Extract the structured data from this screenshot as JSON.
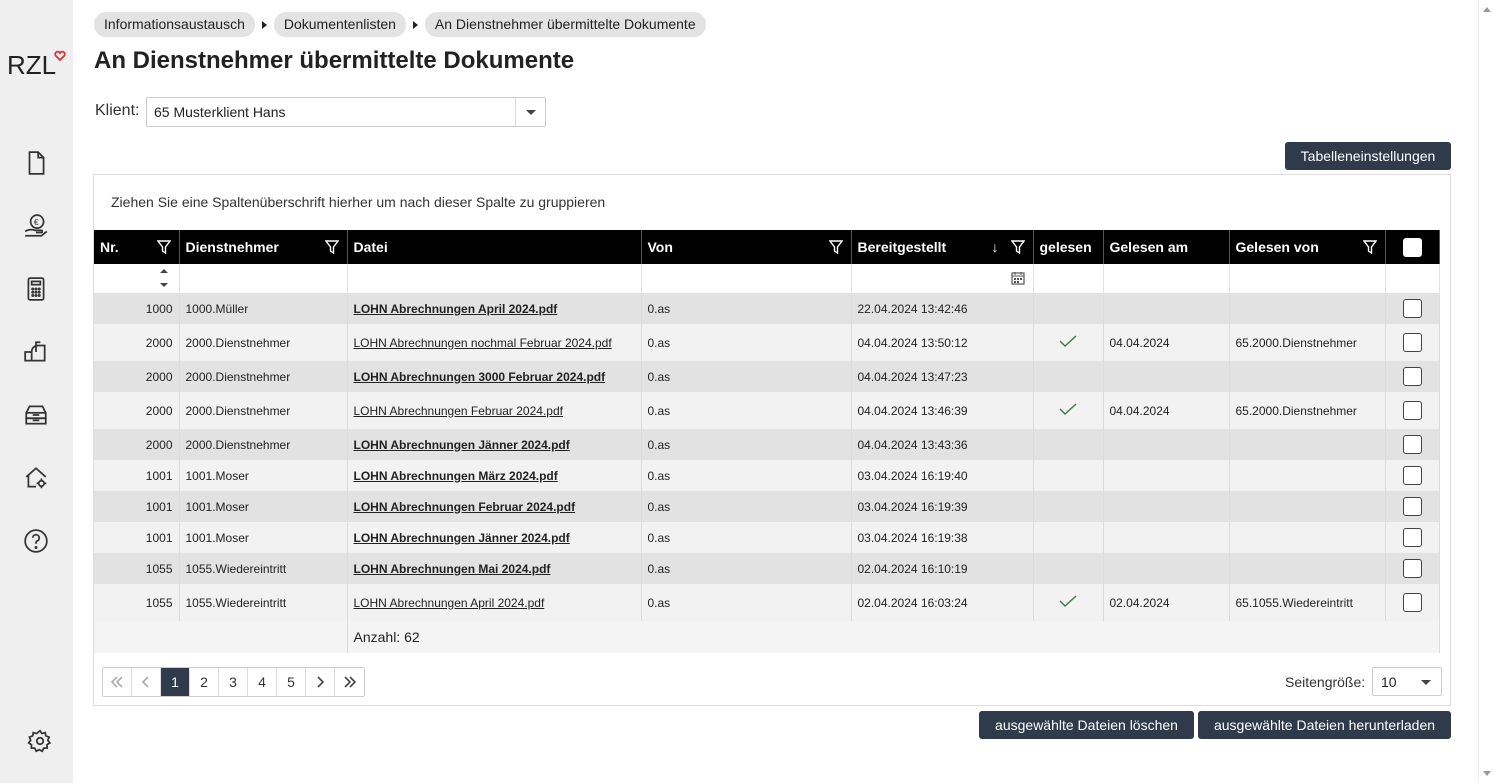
{
  "brand": {
    "logo_text": "RZL"
  },
  "breadcrumb": [
    "Informationsaustausch",
    "Dokumentenlisten",
    "An Dienstnehmer übermittelte Dokumente"
  ],
  "page_title": "An Dienstnehmer übermittelte Dokumente",
  "client": {
    "label": "Klient:",
    "value": "65 Musterklient Hans"
  },
  "table_settings_label": "Tabelleneinstellungen",
  "group_hint": "Ziehen Sie eine Spaltenüberschrift hierher um nach dieser Spalte zu gruppieren",
  "columns": {
    "nr": "Nr.",
    "employee": "Dienstnehmer",
    "file": "Datei",
    "from": "Von",
    "provided": "Bereitgestellt",
    "read": "gelesen",
    "read_at": "Gelesen am",
    "read_by": "Gelesen von"
  },
  "rows": [
    {
      "nr": "1000",
      "employee": "1000.Müller",
      "file": "LOHN Abrechnungen April 2024.pdf",
      "bold": true,
      "from": "0.as",
      "provided": "22.04.2024 13:42:46",
      "read": false,
      "read_at": "",
      "read_by": ""
    },
    {
      "nr": "2000",
      "employee": "2000.Dienstnehmer",
      "file": "LOHN Abrechnungen nochmal Februar 2024.pdf",
      "bold": false,
      "from": "0.as",
      "provided": "04.04.2024 13:50:12",
      "read": true,
      "read_at": "04.04.2024",
      "read_by": "65.2000.Dienstnehmer"
    },
    {
      "nr": "2000",
      "employee": "2000.Dienstnehmer",
      "file": "LOHN Abrechnungen 3000 Februar 2024.pdf",
      "bold": true,
      "from": "0.as",
      "provided": "04.04.2024 13:47:23",
      "read": false,
      "read_at": "",
      "read_by": ""
    },
    {
      "nr": "2000",
      "employee": "2000.Dienstnehmer",
      "file": "LOHN Abrechnungen Februar 2024.pdf",
      "bold": false,
      "from": "0.as",
      "provided": "04.04.2024 13:46:39",
      "read": true,
      "read_at": "04.04.2024",
      "read_by": "65.2000.Dienstnehmer"
    },
    {
      "nr": "2000",
      "employee": "2000.Dienstnehmer",
      "file": "LOHN Abrechnungen Jänner 2024.pdf",
      "bold": true,
      "from": "0.as",
      "provided": "04.04.2024 13:43:36",
      "read": false,
      "read_at": "",
      "read_by": ""
    },
    {
      "nr": "1001",
      "employee": "1001.Moser",
      "file": "LOHN Abrechnungen März 2024.pdf",
      "bold": true,
      "from": "0.as",
      "provided": "03.04.2024 16:19:40",
      "read": false,
      "read_at": "",
      "read_by": ""
    },
    {
      "nr": "1001",
      "employee": "1001.Moser",
      "file": "LOHN Abrechnungen Februar 2024.pdf",
      "bold": true,
      "from": "0.as",
      "provided": "03.04.2024 16:19:39",
      "read": false,
      "read_at": "",
      "read_by": ""
    },
    {
      "nr": "1001",
      "employee": "1001.Moser",
      "file": "LOHN Abrechnungen Jänner 2024.pdf",
      "bold": true,
      "from": "0.as",
      "provided": "03.04.2024 16:19:38",
      "read": false,
      "read_at": "",
      "read_by": ""
    },
    {
      "nr": "1055",
      "employee": "1055.Wiedereintritt",
      "file": "LOHN Abrechnungen Mai 2024.pdf",
      "bold": true,
      "from": "0.as",
      "provided": "02.04.2024 16:10:19",
      "read": false,
      "read_at": "",
      "read_by": ""
    },
    {
      "nr": "1055",
      "employee": "1055.Wiedereintritt",
      "file": "LOHN Abrechnungen April 2024.pdf",
      "bold": false,
      "from": "0.as",
      "provided": "02.04.2024 16:03:24",
      "read": true,
      "read_at": "02.04.2024",
      "read_by": "65.1055.Wiedereintritt"
    }
  ],
  "footer": {
    "count_label": "Anzahl:",
    "count": "62"
  },
  "pager": {
    "pages": [
      "1",
      "2",
      "3",
      "4",
      "5"
    ],
    "current": "1",
    "page_size_label": "Seitengröße:",
    "page_size": "10"
  },
  "actions": {
    "delete_label": "ausgewählte Dateien löschen",
    "download_label": "ausgewählte Dateien herunterladen"
  },
  "sidebar_icons": [
    "document-icon",
    "payroll-icon",
    "calculator-icon",
    "mailbox-icon",
    "archive-icon",
    "home-settings-icon",
    "help-icon",
    "settings-icon"
  ],
  "colors": {
    "accent_dark": "#2f3a4b",
    "header_bg": "#000000",
    "brand_heart": "#e0303a",
    "check_green": "#3a7a45"
  }
}
